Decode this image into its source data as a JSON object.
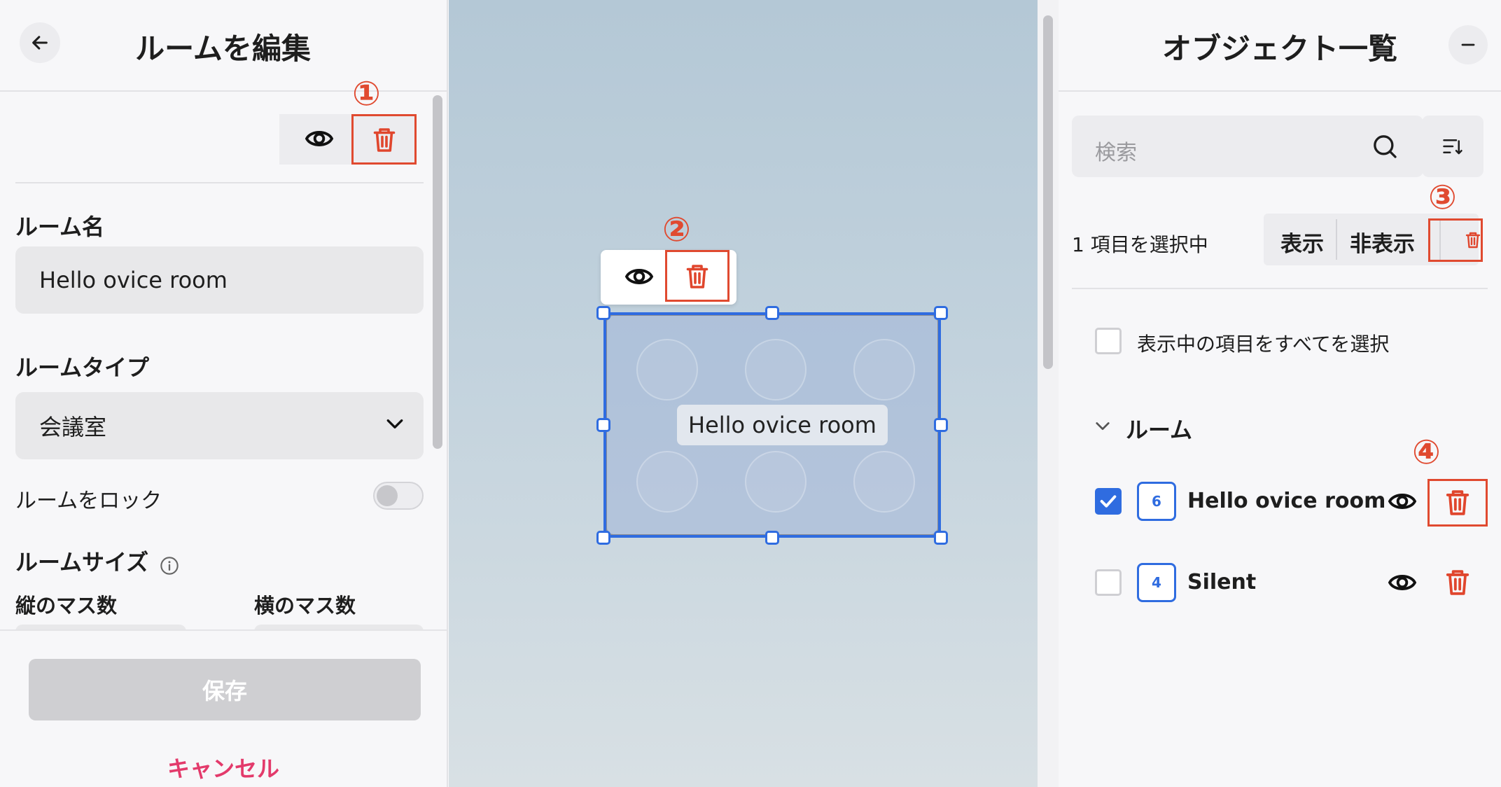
{
  "left_panel": {
    "title": "ルームを編集",
    "room_name_label": "ルーム名",
    "room_name_value": "Hello ovice room",
    "room_type_label": "ルームタイプ",
    "room_type_value": "会議室",
    "lock_label": "ルームをロック",
    "lock_enabled": false,
    "room_size_label": "ルームサイズ",
    "rows_label": "縦のマス数",
    "cols_label": "横のマス数",
    "save_label": "保存",
    "cancel_label": "キャンセル"
  },
  "annotations": {
    "badge1": "①",
    "badge2": "②",
    "badge3": "③",
    "badge4": "④",
    "color": "#e04a30"
  },
  "canvas": {
    "room_label": "Hello ovice room",
    "selection_color": "#2f6ce0"
  },
  "right_panel": {
    "title": "オブジェクト一覧",
    "search_placeholder": "検索",
    "selection_count_text": "1 項目を選択中",
    "show_label": "表示",
    "hide_label": "非表示",
    "select_all_label": "表示中の項目をすべてを選択",
    "section_title": "ルーム",
    "items": [
      {
        "capacity": "6",
        "name": "Hello ovice room",
        "checked": true
      },
      {
        "capacity": "4",
        "name": "Silent",
        "checked": false
      }
    ]
  },
  "colors": {
    "accent": "#2f6ce0",
    "danger": "#e0462d",
    "cancel": "#e33a6b"
  }
}
